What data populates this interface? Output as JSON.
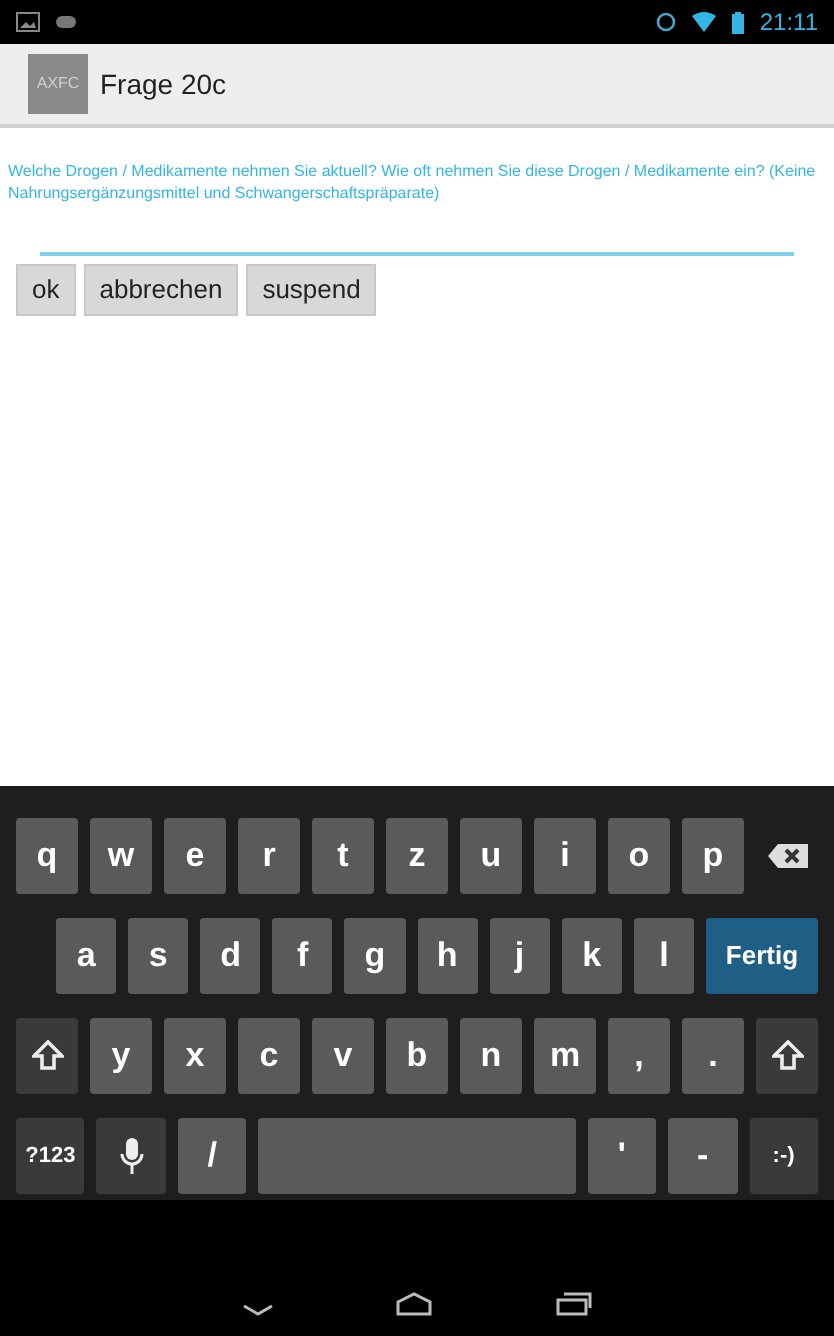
{
  "status_bar": {
    "time": "21:11"
  },
  "action_bar": {
    "logo": "AXFC",
    "title": "Frage 20c"
  },
  "question": "Welche Drogen / Medikamente nehmen Sie aktuell? Wie oft nehmen Sie diese Drogen / Medikamente ein? (Keine Nahrungsergänzungsmittel und Schwangerschaftspräparate)",
  "buttons": [
    "ok",
    "abbrechen",
    "suspend"
  ],
  "keyboard": {
    "key_rows": [
      {
        "keys": [
          {
            "kind": "letter",
            "label": "q"
          },
          {
            "kind": "letter",
            "label": "w"
          },
          {
            "kind": "letter",
            "label": "e"
          },
          {
            "kind": "letter",
            "label": "r"
          },
          {
            "kind": "letter",
            "label": "t"
          },
          {
            "kind": "letter",
            "label": "z"
          },
          {
            "kind": "letter",
            "label": "u"
          },
          {
            "kind": "letter",
            "label": "i"
          },
          {
            "kind": "letter",
            "label": "o"
          },
          {
            "kind": "letter",
            "label": "p"
          },
          {
            "kind": "backspace"
          }
        ]
      },
      {
        "keys": [
          {
            "kind": "letter",
            "label": "a"
          },
          {
            "kind": "letter",
            "label": "s"
          },
          {
            "kind": "letter",
            "label": "d"
          },
          {
            "kind": "letter",
            "label": "f"
          },
          {
            "kind": "letter",
            "label": "g"
          },
          {
            "kind": "letter",
            "label": "h"
          },
          {
            "kind": "letter",
            "label": "j"
          },
          {
            "kind": "letter",
            "label": "k"
          },
          {
            "kind": "letter",
            "label": "l"
          },
          {
            "kind": "action",
            "label": "Fertig"
          }
        ]
      },
      {
        "keys": [
          {
            "kind": "shift"
          },
          {
            "kind": "letter",
            "label": "y"
          },
          {
            "kind": "letter",
            "label": "x"
          },
          {
            "kind": "letter",
            "label": "c"
          },
          {
            "kind": "letter",
            "label": "v"
          },
          {
            "kind": "letter",
            "label": "b"
          },
          {
            "kind": "letter",
            "label": "n"
          },
          {
            "kind": "letter",
            "label": "m"
          },
          {
            "kind": "letter",
            "label": ","
          },
          {
            "kind": "letter",
            "label": "."
          },
          {
            "kind": "shift"
          }
        ]
      },
      {
        "keys": [
          {
            "kind": "function",
            "label": "?123"
          },
          {
            "kind": "mic"
          },
          {
            "kind": "letter",
            "label": "/"
          },
          {
            "kind": "space"
          },
          {
            "kind": "letter",
            "label": "'"
          },
          {
            "kind": "letter",
            "label": "-"
          },
          {
            "kind": "function",
            "label": ":-)"
          }
        ]
      }
    ]
  }
}
